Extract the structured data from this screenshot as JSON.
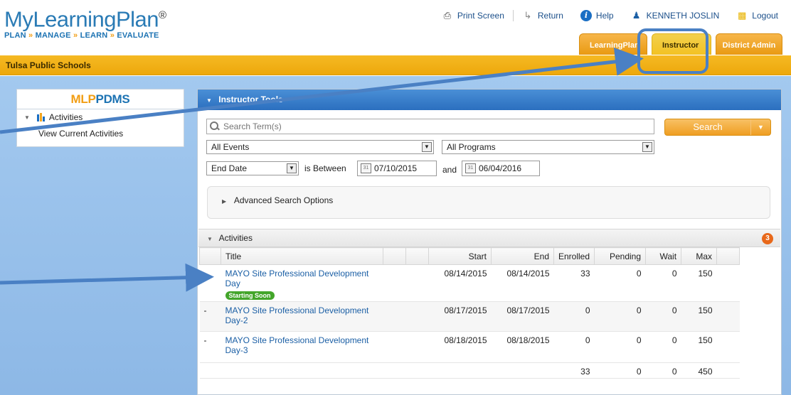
{
  "header": {
    "logo_main": "MyLearningPlan",
    "logo_reg": "®",
    "logo_sub": [
      "PLAN",
      "MANAGE",
      "LEARN",
      "EVALUATE"
    ],
    "logo_sep": "»",
    "links": {
      "print": "Print Screen",
      "return": "Return",
      "help": "Help",
      "user": "KENNETH JOSLIN",
      "logout": "Logout"
    },
    "tabs": [
      "LearningPlan",
      "Instructor",
      "District Admin"
    ],
    "active_tab": "Instructor"
  },
  "org_name": "Tulsa Public Schools",
  "sidebar": {
    "brand_a": "MLP",
    "brand_b": "PDMS",
    "section": "Activities",
    "items": [
      "View Current Activities"
    ]
  },
  "panel": {
    "title": "Instructor Tools",
    "search_placeholder": "Search Term(s)",
    "search_button": "Search",
    "events_select": "All Events",
    "programs_select": "All Programs",
    "date_type_select": "End Date",
    "is_between": "is Between",
    "and": "and",
    "start_date": "07/10/2015",
    "end_date": "06/04/2016",
    "calendar_day": "31",
    "advanced": "Advanced Search Options"
  },
  "activities": {
    "title": "Activities",
    "count": "3",
    "columns": [
      "Title",
      "Start",
      "End",
      "Enrolled",
      "Pending",
      "Wait",
      "Max"
    ],
    "rows": [
      {
        "prefix": "",
        "title": "MAYO Site Professional Development Day",
        "badge": "Starting Soon",
        "start": "08/14/2015",
        "end": "08/14/2015",
        "enrolled": "33",
        "pending": "0",
        "wait": "0",
        "max": "150"
      },
      {
        "prefix": "-",
        "title": "MAYO Site Professional Development Day-2",
        "badge": "",
        "start": "08/17/2015",
        "end": "08/17/2015",
        "enrolled": "0",
        "pending": "0",
        "wait": "0",
        "max": "150"
      },
      {
        "prefix": "-",
        "title": "MAYO Site Professional Development Day-3",
        "badge": "",
        "start": "08/18/2015",
        "end": "08/18/2015",
        "enrolled": "0",
        "pending": "0",
        "wait": "0",
        "max": "150"
      }
    ],
    "totals": {
      "enrolled": "33",
      "pending": "0",
      "wait": "0",
      "max": "450"
    }
  },
  "colors": {
    "brand_blue": "#2a7bb5",
    "accent_orange": "#f29e14",
    "panel_blue": "#2b6fbf",
    "content_bg": "#a3c9ef",
    "annotation_arrow": "#4a80c4"
  }
}
